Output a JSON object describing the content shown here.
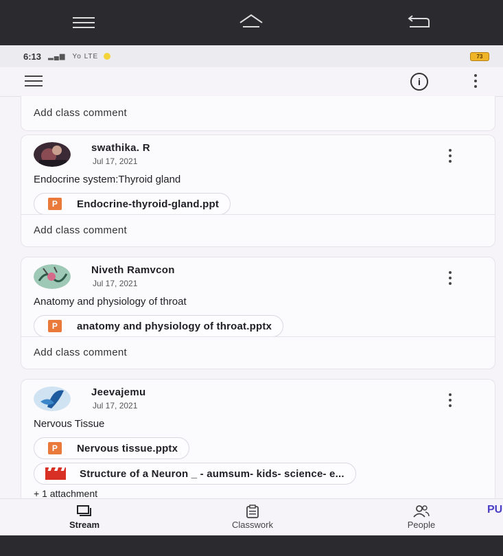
{
  "status": {
    "time": "6:13",
    "signal_text": "Yo LTE",
    "battery": "73"
  },
  "appbar": {
    "info_icon": "info-icon"
  },
  "comment_label": "Add class comment",
  "posts": [
    {
      "author": "swathika. R",
      "date": "Jul 17, 2021",
      "title": "Endocrine system:Thyroid gland",
      "attachments": [
        {
          "icon": "P",
          "name": "Endocrine-thyroid-gland.ppt"
        }
      ]
    },
    {
      "author": "Niveth Ramvcon",
      "date": "Jul 17, 2021",
      "title": "Anatomy and physiology of throat",
      "attachments": [
        {
          "icon": "P",
          "name": "anatomy and physiology of throat.pptx"
        }
      ]
    },
    {
      "author": "Jeevajemu",
      "date": "Jul 17, 2021",
      "title": "Nervous Tissue",
      "attachments": [
        {
          "icon": "P",
          "name": "Nervous tissue.pptx"
        },
        {
          "icon": "video",
          "name": "Structure of a Neuron _ - aumsum- kids- science- e..."
        }
      ],
      "more": "+ 1 attachment"
    }
  ],
  "nav": {
    "stream": "Stream",
    "classwork": "Classwork",
    "people": "People"
  },
  "edge_text": "PU",
  "colors": {
    "ppt_icon": "#ea7a3b",
    "video_icon": "#d93025",
    "accent_text": "#4a3ec4"
  }
}
